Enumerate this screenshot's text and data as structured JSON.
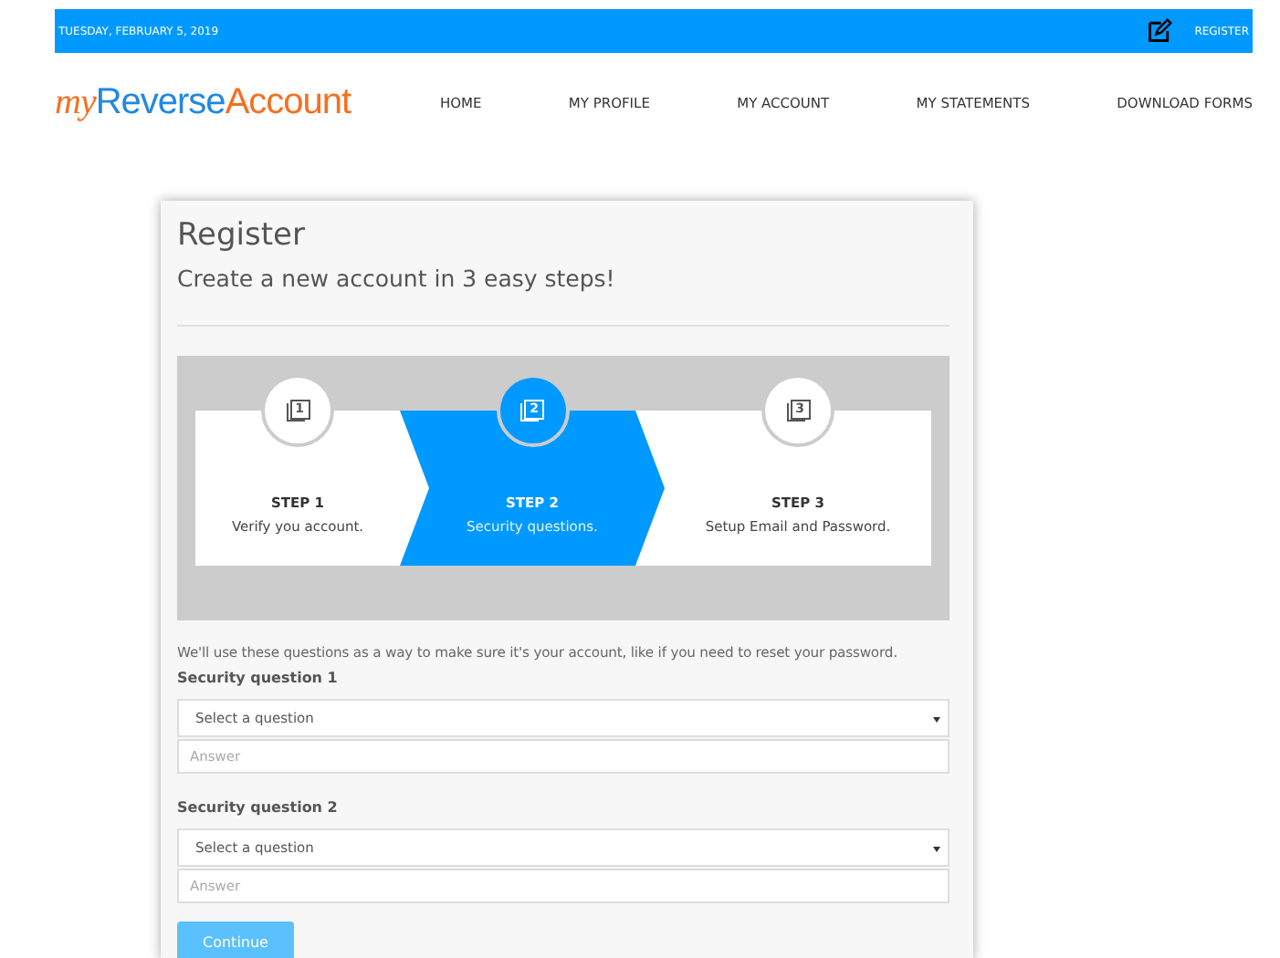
{
  "top_bar": {
    "date": "TUESDAY, FEBRUARY 5, 2019",
    "register_link": "REGISTER"
  },
  "logo": [
    "my",
    "Reverse",
    "Account"
  ],
  "nav": [
    "HOME",
    "MY PROFILE",
    "MY ACCOUNT",
    "MY STATEMENTS",
    "DOWNLOAD FORMS"
  ],
  "card": {
    "title": "Register",
    "subtitle": "Create a new account in 3 easy steps!"
  },
  "steps": [
    {
      "number": "1",
      "title": "STEP 1",
      "text": "Verify you account.",
      "selected": false
    },
    {
      "number": "2",
      "title": "STEP 2",
      "text": "Security questions.",
      "selected": true
    },
    {
      "number": "3",
      "title": "STEP 3",
      "text": "Setup Email and Password.",
      "selected": false
    }
  ],
  "intro": "We'll use these questions as a way to make sure it's your account, like if you need to reset your password.",
  "questions": [
    {
      "label": "Security question 1",
      "select": "Select a question",
      "placeholder": "Answer"
    },
    {
      "label": "Security question 2",
      "select": "Select a question",
      "placeholder": "Answer"
    }
  ],
  "continue_button": {
    "label": "Continue",
    "disabled": true
  }
}
